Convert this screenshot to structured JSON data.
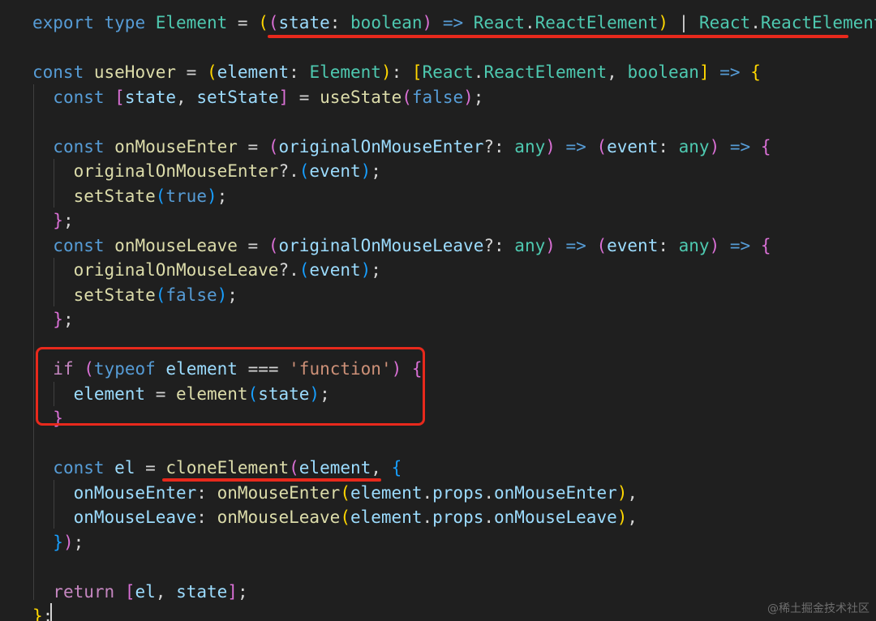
{
  "code_lines": [
    [
      [
        "export",
        "kw-blue"
      ],
      [
        " ",
        "op"
      ],
      [
        "type",
        "kw-blue"
      ],
      [
        " ",
        "op"
      ],
      [
        "Element",
        "type"
      ],
      [
        " = ",
        "op"
      ],
      [
        "(",
        "brk1"
      ],
      [
        "(",
        "brk2"
      ],
      [
        "state",
        "var"
      ],
      [
        ": ",
        "op"
      ],
      [
        "boolean",
        "type"
      ],
      [
        ")",
        "brk2"
      ],
      [
        " => ",
        "kw-blue"
      ],
      [
        "React",
        "type"
      ],
      [
        ".",
        "op"
      ],
      [
        "ReactElement",
        "type"
      ],
      [
        ")",
        "brk1"
      ],
      [
        " | ",
        "op"
      ],
      [
        "React",
        "type"
      ],
      [
        ".",
        "op"
      ],
      [
        "ReactElement",
        "type"
      ],
      [
        ";",
        "op"
      ]
    ],
    [],
    [
      [
        "const",
        "kw-blue"
      ],
      [
        " ",
        "op"
      ],
      [
        "useHover",
        "fn"
      ],
      [
        " = ",
        "op"
      ],
      [
        "(",
        "brk1"
      ],
      [
        "element",
        "var"
      ],
      [
        ": ",
        "op"
      ],
      [
        "Element",
        "type"
      ],
      [
        ")",
        "brk1"
      ],
      [
        ": ",
        "op"
      ],
      [
        "[",
        "brk1"
      ],
      [
        "React",
        "type"
      ],
      [
        ".",
        "op"
      ],
      [
        "ReactElement",
        "type"
      ],
      [
        ", ",
        "op"
      ],
      [
        "boolean",
        "type"
      ],
      [
        "]",
        "brk1"
      ],
      [
        " => ",
        "kw-blue"
      ],
      [
        "{",
        "brk1"
      ]
    ],
    [
      [
        "  ",
        "op"
      ],
      [
        "const",
        "kw-blue"
      ],
      [
        " ",
        "op"
      ],
      [
        "[",
        "brk2"
      ],
      [
        "state",
        "var"
      ],
      [
        ", ",
        "op"
      ],
      [
        "setState",
        "var"
      ],
      [
        "]",
        "brk2"
      ],
      [
        " = ",
        "op"
      ],
      [
        "useState",
        "fn"
      ],
      [
        "(",
        "brk2"
      ],
      [
        "false",
        "const"
      ],
      [
        ")",
        "brk2"
      ],
      [
        ";",
        "op"
      ]
    ],
    [],
    [
      [
        "  ",
        "op"
      ],
      [
        "const",
        "kw-blue"
      ],
      [
        " ",
        "op"
      ],
      [
        "onMouseEnter",
        "fn"
      ],
      [
        " = ",
        "op"
      ],
      [
        "(",
        "brk2"
      ],
      [
        "originalOnMouseEnter",
        "var"
      ],
      [
        "?: ",
        "op"
      ],
      [
        "any",
        "type"
      ],
      [
        ")",
        "brk2"
      ],
      [
        " => ",
        "kw-blue"
      ],
      [
        "(",
        "brk2"
      ],
      [
        "event",
        "var"
      ],
      [
        ": ",
        "op"
      ],
      [
        "any",
        "type"
      ],
      [
        ")",
        "brk2"
      ],
      [
        " => ",
        "kw-blue"
      ],
      [
        "{",
        "brk2"
      ]
    ],
    [
      [
        "    ",
        "op"
      ],
      [
        "originalOnMouseEnter",
        "fn"
      ],
      [
        "?.",
        "op"
      ],
      [
        "(",
        "brk3"
      ],
      [
        "event",
        "var"
      ],
      [
        ")",
        "brk3"
      ],
      [
        ";",
        "op"
      ]
    ],
    [
      [
        "    ",
        "op"
      ],
      [
        "setState",
        "fn"
      ],
      [
        "(",
        "brk3"
      ],
      [
        "true",
        "const"
      ],
      [
        ")",
        "brk3"
      ],
      [
        ";",
        "op"
      ]
    ],
    [
      [
        "  ",
        "op"
      ],
      [
        "}",
        "brk2"
      ],
      [
        ";",
        "op"
      ]
    ],
    [
      [
        "  ",
        "op"
      ],
      [
        "const",
        "kw-blue"
      ],
      [
        " ",
        "op"
      ],
      [
        "onMouseLeave",
        "fn"
      ],
      [
        " = ",
        "op"
      ],
      [
        "(",
        "brk2"
      ],
      [
        "originalOnMouseLeave",
        "var"
      ],
      [
        "?: ",
        "op"
      ],
      [
        "any",
        "type"
      ],
      [
        ")",
        "brk2"
      ],
      [
        " => ",
        "kw-blue"
      ],
      [
        "(",
        "brk2"
      ],
      [
        "event",
        "var"
      ],
      [
        ": ",
        "op"
      ],
      [
        "any",
        "type"
      ],
      [
        ")",
        "brk2"
      ],
      [
        " => ",
        "kw-blue"
      ],
      [
        "{",
        "brk2"
      ]
    ],
    [
      [
        "    ",
        "op"
      ],
      [
        "originalOnMouseLeave",
        "fn"
      ],
      [
        "?.",
        "op"
      ],
      [
        "(",
        "brk3"
      ],
      [
        "event",
        "var"
      ],
      [
        ")",
        "brk3"
      ],
      [
        ";",
        "op"
      ]
    ],
    [
      [
        "    ",
        "op"
      ],
      [
        "setState",
        "fn"
      ],
      [
        "(",
        "brk3"
      ],
      [
        "false",
        "const"
      ],
      [
        ")",
        "brk3"
      ],
      [
        ";",
        "op"
      ]
    ],
    [
      [
        "  ",
        "op"
      ],
      [
        "}",
        "brk2"
      ],
      [
        ";",
        "op"
      ]
    ],
    [],
    [
      [
        "  ",
        "op"
      ],
      [
        "if",
        "kw-purple"
      ],
      [
        " ",
        "op"
      ],
      [
        "(",
        "brk2"
      ],
      [
        "typeof",
        "kw-blue"
      ],
      [
        " ",
        "op"
      ],
      [
        "element",
        "var"
      ],
      [
        " === ",
        "op"
      ],
      [
        "'function'",
        "str"
      ],
      [
        ")",
        "brk2"
      ],
      [
        " ",
        "op"
      ],
      [
        "{",
        "brk2"
      ]
    ],
    [
      [
        "    ",
        "op"
      ],
      [
        "element",
        "var"
      ],
      [
        " = ",
        "op"
      ],
      [
        "element",
        "fn"
      ],
      [
        "(",
        "brk3"
      ],
      [
        "state",
        "var"
      ],
      [
        ")",
        "brk3"
      ],
      [
        ";",
        "op"
      ]
    ],
    [
      [
        "  ",
        "op"
      ],
      [
        "}",
        "brk2"
      ]
    ],
    [],
    [
      [
        "  ",
        "op"
      ],
      [
        "const",
        "kw-blue"
      ],
      [
        " ",
        "op"
      ],
      [
        "el",
        "var"
      ],
      [
        " = ",
        "op"
      ],
      [
        "cloneElement",
        "fn"
      ],
      [
        "(",
        "brk2"
      ],
      [
        "element",
        "var"
      ],
      [
        ", ",
        "op"
      ],
      [
        "{",
        "brk3"
      ]
    ],
    [
      [
        "    ",
        "op"
      ],
      [
        "onMouseEnter",
        "var"
      ],
      [
        ": ",
        "op"
      ],
      [
        "onMouseEnter",
        "fn"
      ],
      [
        "(",
        "brk1"
      ],
      [
        "element",
        "var"
      ],
      [
        ".",
        "op"
      ],
      [
        "props",
        "var"
      ],
      [
        ".",
        "op"
      ],
      [
        "onMouseEnter",
        "var"
      ],
      [
        ")",
        "brk1"
      ],
      [
        ",",
        "op"
      ]
    ],
    [
      [
        "    ",
        "op"
      ],
      [
        "onMouseLeave",
        "var"
      ],
      [
        ": ",
        "op"
      ],
      [
        "onMouseLeave",
        "fn"
      ],
      [
        "(",
        "brk1"
      ],
      [
        "element",
        "var"
      ],
      [
        ".",
        "op"
      ],
      [
        "props",
        "var"
      ],
      [
        ".",
        "op"
      ],
      [
        "onMouseLeave",
        "var"
      ],
      [
        ")",
        "brk1"
      ],
      [
        ",",
        "op"
      ]
    ],
    [
      [
        "  ",
        "op"
      ],
      [
        "}",
        "brk3"
      ],
      [
        ")",
        "brk2"
      ],
      [
        ";",
        "op"
      ]
    ],
    [],
    [
      [
        "  ",
        "op"
      ],
      [
        "return",
        "kw-purple"
      ],
      [
        " ",
        "op"
      ],
      [
        "[",
        "brk2"
      ],
      [
        "el",
        "var"
      ],
      [
        ", ",
        "op"
      ],
      [
        "state",
        "var"
      ],
      [
        "]",
        "brk2"
      ],
      [
        ";",
        "op"
      ]
    ],
    [
      [
        "}",
        "brk1"
      ],
      [
        ";",
        "op"
      ]
    ]
  ],
  "watermark": "@稀土掘金技术社区",
  "colors": {
    "background": "#1f1f1f",
    "annotation": "#e8291c"
  }
}
